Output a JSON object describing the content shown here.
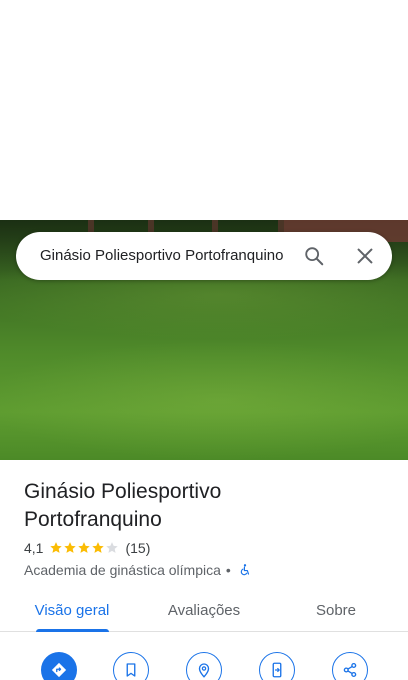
{
  "search": {
    "query": "Ginásio Poliesportivo Portofranquino",
    "search_icon": "search-icon",
    "close_icon": "close-icon"
  },
  "place": {
    "name": "Ginásio Poliesportivo Portofranquino",
    "rating": "4,1",
    "rating_value": 4.1,
    "review_count": "(15)",
    "category": "Academia de ginástica olímpica",
    "separator": "•",
    "accessibility_icon": "wheelchair-icon"
  },
  "tabs": [
    {
      "label": "Visão geral",
      "active": true
    },
    {
      "label": "Avaliações",
      "active": false
    },
    {
      "label": "Sobre",
      "active": false
    }
  ],
  "actions": [
    {
      "icon": "directions-icon"
    },
    {
      "icon": "bookmark-icon"
    },
    {
      "icon": "nearby-icon"
    },
    {
      "icon": "send-to-phone-icon"
    },
    {
      "icon": "share-icon"
    }
  ],
  "colors": {
    "accent": "#1a73e8",
    "star": "#fbbc04",
    "star_empty": "#dadce0"
  }
}
